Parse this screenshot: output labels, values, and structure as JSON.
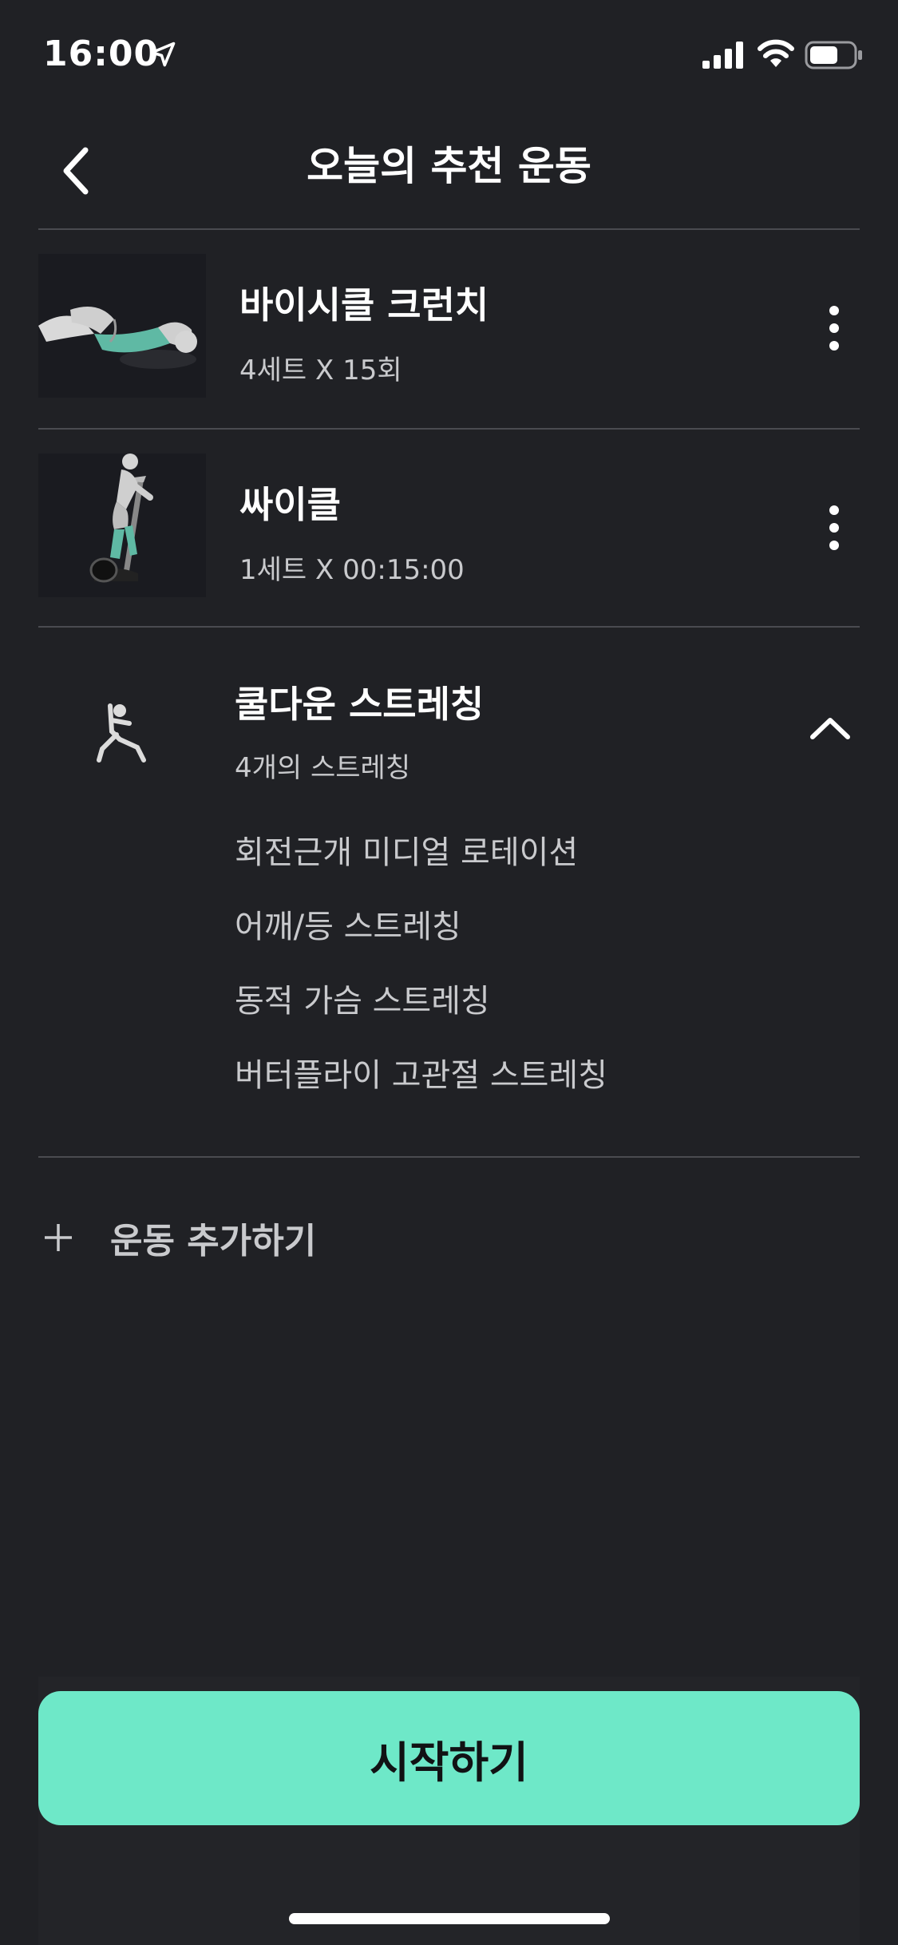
{
  "status_bar": {
    "time": "16:00",
    "icons": [
      "location-arrow-icon",
      "cellular-signal-icon",
      "wifi-icon",
      "battery-icon"
    ]
  },
  "header": {
    "title": "오늘의 추천 운동",
    "back_icon": "chevron-left-icon"
  },
  "exercises": [
    {
      "name": "바이시클 크런치",
      "detail": "4세트 X 15회",
      "thumbnail": "bicycle-crunch-illustration"
    },
    {
      "name": "싸이클",
      "detail": "1세트 X 00:15:00",
      "thumbnail": "stationary-bike-illustration"
    }
  ],
  "cooldown": {
    "title": "쿨다운 스트레칭",
    "count": "4개의 스트레칭",
    "icon": "stretching-person-icon",
    "items": [
      "회전근개 미디얼 로테이션",
      "어깨/등 스트레칭",
      "동적 가슴 스트레칭",
      "버터플라이 고관절 스트레칭"
    ]
  },
  "add_exercise": {
    "label": "운동 추가하기",
    "icon": "plus-icon"
  },
  "start_button": {
    "label": "시작하기"
  },
  "colors": {
    "background": "#202125",
    "accent": "#6ee8c8",
    "divider": "#4a4b50",
    "secondary_text": "#c9cacd"
  }
}
